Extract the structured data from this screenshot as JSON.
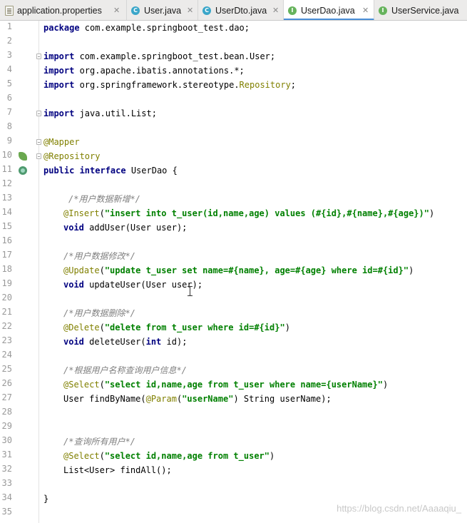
{
  "tabs": [
    {
      "label": "application.properties",
      "icon": "properties-file-icon",
      "active": false
    },
    {
      "label": "User.java",
      "icon": "class-file-icon",
      "active": false
    },
    {
      "label": "UserDto.java",
      "icon": "class-file-icon",
      "active": false
    },
    {
      "label": "UserDao.java",
      "icon": "interface-file-icon",
      "active": true
    },
    {
      "label": "UserService.java",
      "icon": "interface-file-icon",
      "active": false
    }
  ],
  "tab_glyphs": {
    "class": "C",
    "interface": "I",
    "close": "✕"
  },
  "line_numbers": [
    "1",
    "2",
    "3",
    "4",
    "5",
    "6",
    "7",
    "8",
    "9",
    "10",
    "11",
    "12",
    "13",
    "14",
    "15",
    "16",
    "17",
    "18",
    "19",
    "20",
    "21",
    "22",
    "23",
    "24",
    "25",
    "26",
    "27",
    "28",
    "29",
    "30",
    "31",
    "32",
    "33",
    "34",
    "35"
  ],
  "code": {
    "l1": {
      "kw": "package",
      "rest": " com.example.springboot_test.dao;"
    },
    "l3": {
      "kw": "import",
      "rest": " com.example.springboot_test.bean.User;"
    },
    "l4": {
      "kw": "import",
      "rest": " org.apache.ibatis.annotations.*;"
    },
    "l5": {
      "kw": "import",
      "rest": " org.springframework.stereotype.",
      "ann": "Repository",
      "tail": ";"
    },
    "l7": {
      "kw": "import",
      "rest": " java.util.List;"
    },
    "l9": {
      "ann": "@Mapper"
    },
    "l10": {
      "ann": "@Repository"
    },
    "l11": {
      "kw": "public interface",
      "rest": " UserDao ",
      "brace": "{"
    },
    "l13": {
      "cmt": "/*用户数据新增*/"
    },
    "l14": {
      "ann": "@Insert",
      "open": "(",
      "str": "\"insert into t_user(id,name,age) values (#{id},#{name},#{age})\"",
      "close": ")"
    },
    "l15": {
      "kw": "void",
      "rest": " addUser(User user);"
    },
    "l17": {
      "cmt": "/*用户数据修改*/"
    },
    "l18": {
      "ann": "@Update",
      "open": "(",
      "str": "\"update t_user set name=#{name}, age=#{age} where id=#{id}\"",
      "close": ")"
    },
    "l19": {
      "kw": "void",
      "rest": " updateUser(User user);"
    },
    "l21": {
      "cmt": "/*用户数据删除*/"
    },
    "l22": {
      "ann": "@Delete",
      "open": "(",
      "str": "\"delete from t_user where id=#{id}\"",
      "close": ")"
    },
    "l23": {
      "kw": "void",
      "rest": " deleteUser(",
      "kw2": "int",
      "tail": " id);"
    },
    "l25": {
      "cmt": "/*根据用户名称查询用户信息*/"
    },
    "l26": {
      "ann": "@Select",
      "open": "(",
      "str": "\"select id,name,age from t_user where name={userName}\"",
      "close": ")"
    },
    "l27": {
      "rest": "User findByName(",
      "ann": "@Param",
      "open": "(",
      "str": "\"userName\"",
      "tail": ") String userName);"
    },
    "l30": {
      "cmt": "/*查询所有用户*/"
    },
    "l31": {
      "ann": "@Select",
      "open": "(",
      "str": "\"select id,name,age from t_user\"",
      "close": ")"
    },
    "l32": {
      "rest": "List<User> findAll();"
    },
    "l34": {
      "brace": "}"
    }
  },
  "watermark": "https://blog.csdn.net/Aaaaqiu_",
  "colors": {
    "keyword": "#000080",
    "annotation": "#808000",
    "string": "#008000",
    "comment": "#808080",
    "tab_active_underline": "#4a8fd8"
  }
}
